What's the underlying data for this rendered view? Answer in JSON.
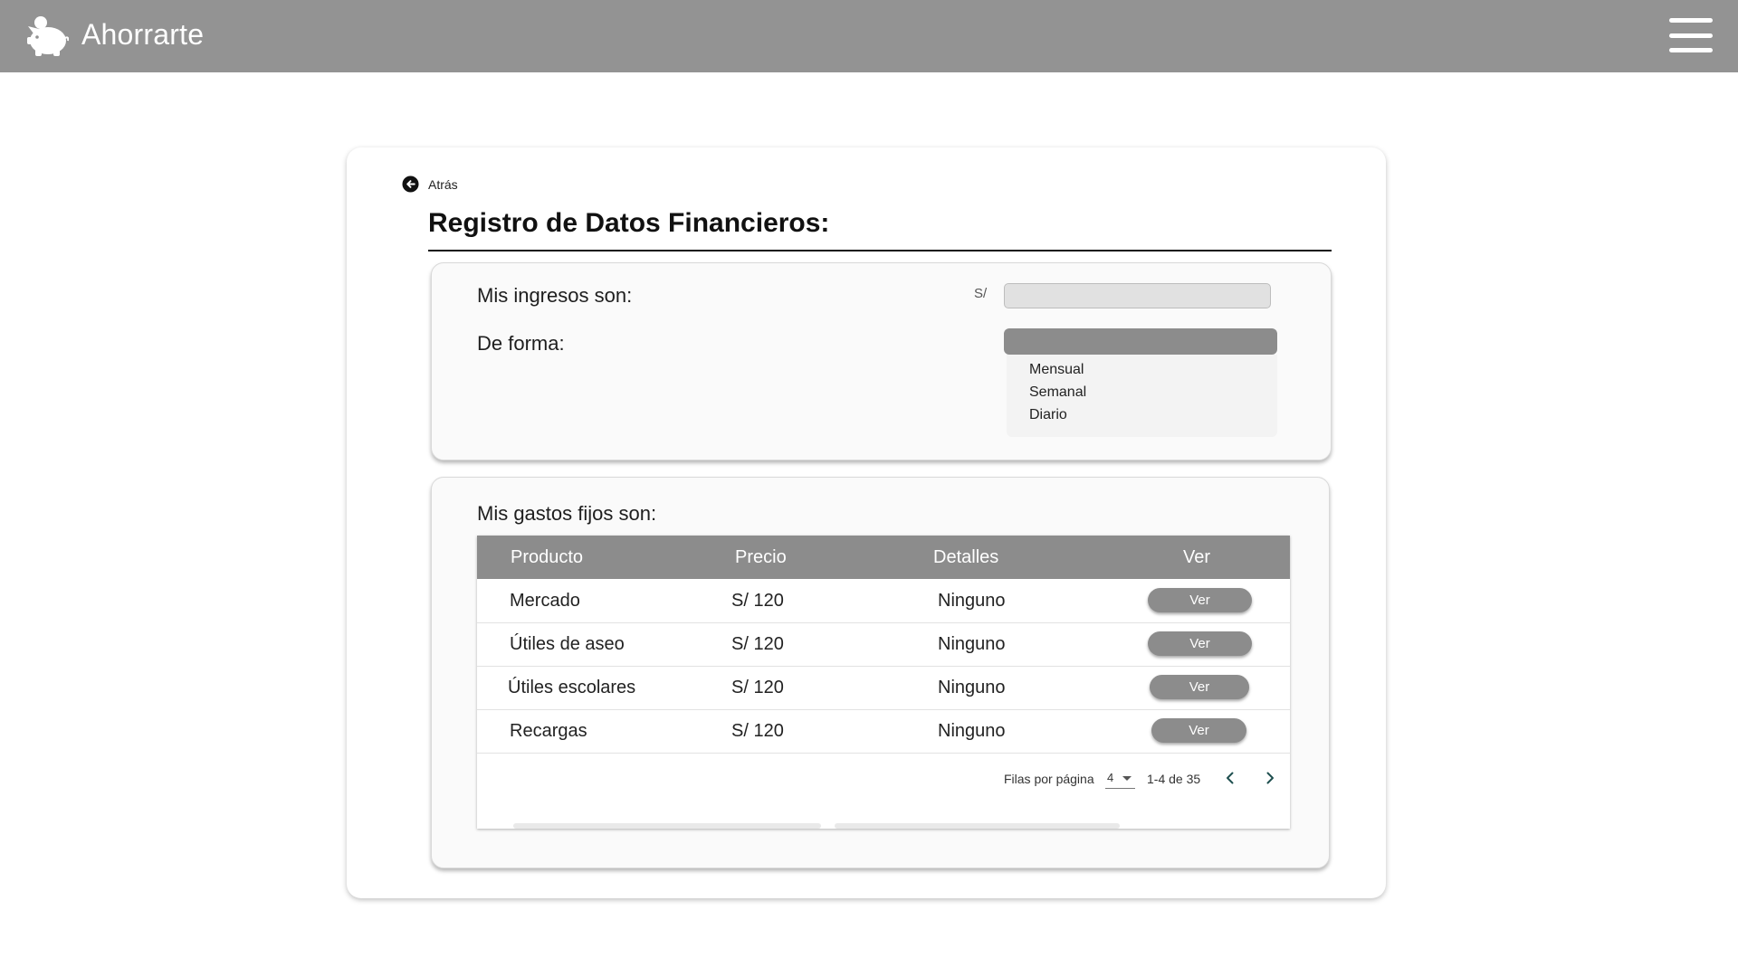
{
  "app": {
    "brand": "Ahorrarte"
  },
  "nav": {
    "back_label": "Atrás"
  },
  "page": {
    "title": "Registro de Datos Financieros:"
  },
  "income": {
    "label": "Mis ingresos son:",
    "currency": "S/",
    "value": "",
    "frequency_label": "De forma:",
    "frequency_options": [
      "Mensual",
      "Semanal",
      "Diario"
    ]
  },
  "expenses": {
    "label": "Mis gastos fijos son:",
    "columns": [
      "Producto",
      "Precio",
      "Detalles",
      "Ver"
    ],
    "rows": [
      {
        "product": "Mercado",
        "price": "S/ 120",
        "details": "Ninguno",
        "action": "Ver"
      },
      {
        "product": "Útiles de aseo",
        "price": "S/ 120",
        "details": "Ninguno",
        "action": "Ver"
      },
      {
        "product": "Útiles escolares",
        "price": "S/ 120",
        "details": "Ninguno",
        "action": "Ver"
      },
      {
        "product": "Recargas",
        "price": "S/ 120",
        "details": "Ninguno",
        "action": "Ver"
      }
    ],
    "pagination": {
      "rows_per_page_label": "Filas por página",
      "rows_per_page": "4",
      "range": "1-4 de 35"
    }
  },
  "colors": {
    "topbar": "#939393",
    "accent_gray": "#8c8c8c",
    "input_bg": "#e1e1e1"
  },
  "icons": [
    "piggy-bank-icon",
    "hamburger-menu-icon",
    "arrow-left-circle-icon",
    "chevron-left-icon",
    "chevron-right-icon",
    "caret-down-icon"
  ]
}
